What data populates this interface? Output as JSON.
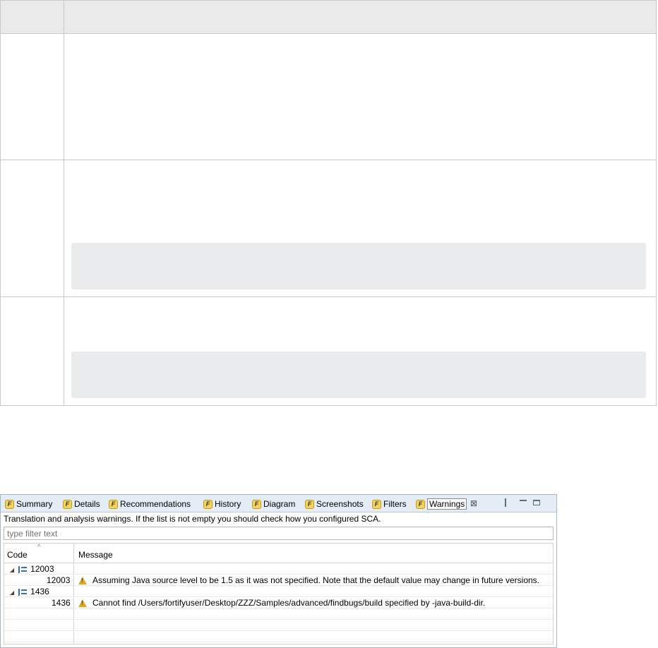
{
  "tabs": [
    {
      "label": "Summary",
      "active": false
    },
    {
      "label": "Details",
      "active": false
    },
    {
      "label": "Recommendations",
      "active": false
    },
    {
      "label": "History",
      "active": false
    },
    {
      "label": "Diagram",
      "active": false
    },
    {
      "label": "Screenshots",
      "active": false
    },
    {
      "label": "Filters",
      "active": false
    },
    {
      "label": "Warnings",
      "active": true
    }
  ],
  "tab_icon_glyph": "F",
  "close_glyph": "⊠",
  "description": "Translation and analysis warnings. If the list is not empty you should check how you configured SCA.",
  "filter": {
    "placeholder": "type filter text"
  },
  "columns": {
    "code": "Code",
    "message": "Message"
  },
  "groups": [
    {
      "code": "12003",
      "rows": [
        {
          "code": "12003",
          "message": "Assuming Java source level to be 1.5 as it was not specified. Note that the default value may change in future versions."
        }
      ]
    },
    {
      "code": "1436",
      "rows": [
        {
          "code": "1436",
          "message": "Cannot find /Users/fortifyuser/Desktop/ZZZ/Samples/advanced/findbugs/build specified by -java-build-dir."
        }
      ]
    }
  ],
  "colors": {
    "tabbar_bg": "#e4ecf6",
    "panel_border": "#a7b6c7",
    "warning": "#e3a91c",
    "tab_icon": "#f3d35a"
  }
}
